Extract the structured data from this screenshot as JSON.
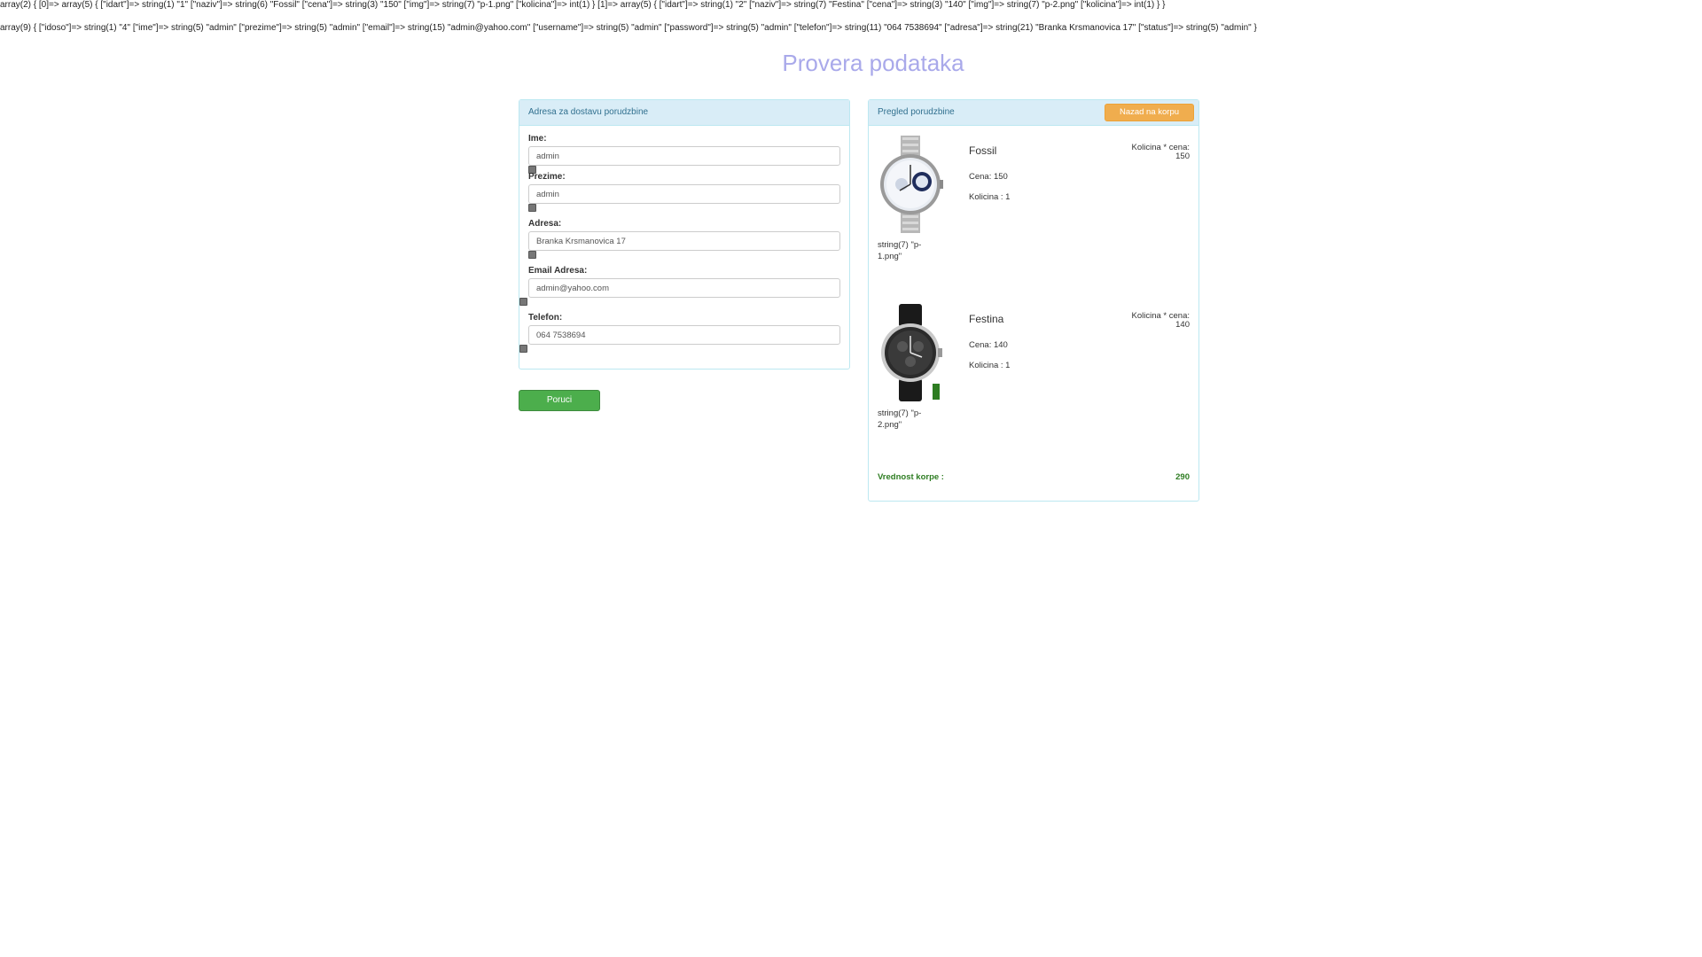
{
  "debug": {
    "line1": "array(2) { [0]=> array(5) { [\"idart\"]=> string(1) \"1\" [\"naziv\"]=> string(6) \"Fossil\" [\"cena\"]=> string(3) \"150\" [\"img\"]=> string(7) \"p-1.png\" [\"kolicina\"]=> int(1) } [1]=> array(5) { [\"idart\"]=> string(1) \"2\" [\"naziv\"]=> string(7) \"Festina\" [\"cena\"]=> string(3) \"140\" [\"img\"]=> string(7) \"p-2.png\" [\"kolicina\"]=> int(1) } }",
    "line2": "array(9) { [\"idoso\"]=> string(1) \"4\" [\"ime\"]=> string(5) \"admin\" [\"prezime\"]=> string(5) \"admin\" [\"email\"]=> string(15) \"admin@yahoo.com\" [\"username\"]=> string(5) \"admin\" [\"password\"]=> string(5) \"admin\" [\"telefon\"]=> string(11) \"064 7538694\" [\"adresa\"]=> string(21) \"Branka Krsmanovica 17\" [\"status\"]=> string(5) \"admin\" }"
  },
  "page_title": "Provera podataka",
  "address_panel": {
    "heading": "Adresa za dostavu porudzbine",
    "fields": [
      {
        "label": "Ime:",
        "value": "admin"
      },
      {
        "label": "Prezime:",
        "value": "admin"
      },
      {
        "label": "Adresa:",
        "value": "Branka Krsmanovica 17"
      },
      {
        "label": "Email Adresa:",
        "value": "admin@yahoo.com"
      },
      {
        "label": "Telefon:",
        "value": "064 7538694"
      }
    ]
  },
  "order_button": "Poruci",
  "review_panel": {
    "heading": "Pregled porudzbine",
    "back_button": "Nazad na korpu",
    "items": [
      {
        "name": "Fossil",
        "price": "Cena: 150",
        "quantity": "Kolicina : 1",
        "total_label": "Kolicina * cena:",
        "total_value": "150",
        "caption": "string(7) \"p-1.png\""
      },
      {
        "name": "Festina",
        "price": "Cena: 140",
        "quantity": "Kolicina : 1",
        "total_label": "Kolicina * cena:",
        "total_value": "140",
        "caption": "string(7) \"p-2.png\""
      }
    ],
    "cart_total_label": "Vrednost korpe :",
    "cart_total_value": "290"
  },
  "colors": {
    "title": "#a9a9ea",
    "panel_heading_bg": "#d9edf7",
    "success_button": "#4cae4c",
    "warning_button": "#f0ad4e",
    "total_text": "#2e7d22"
  },
  "icons": [
    "watch-image",
    "checkbox"
  ]
}
